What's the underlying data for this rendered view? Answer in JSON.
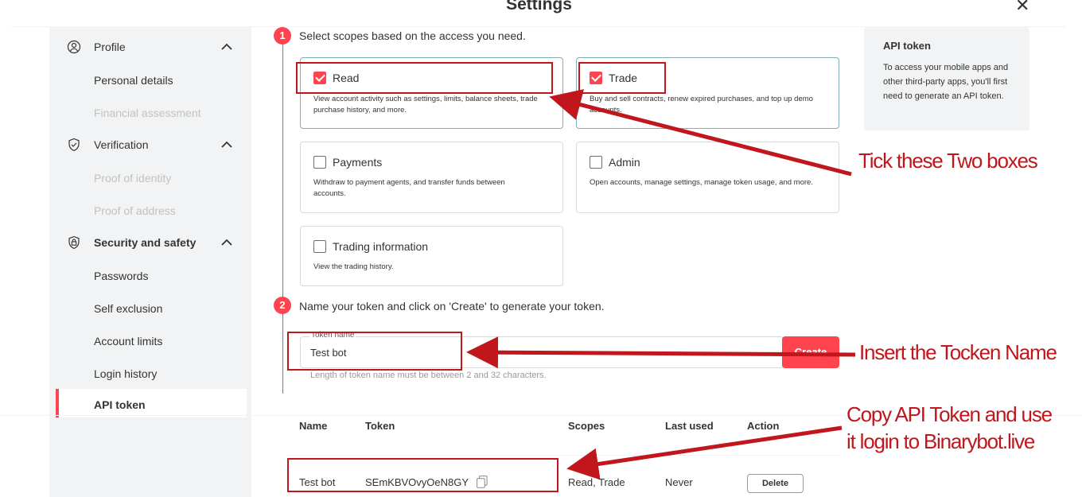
{
  "header": {
    "title": "Settings",
    "close_icon": "close-icon"
  },
  "sidebar": {
    "groups": [
      {
        "label": "Profile",
        "icon": "user-icon",
        "items": [
          {
            "label": "Personal details",
            "disabled": false
          },
          {
            "label": "Financial assessment",
            "disabled": true
          }
        ]
      },
      {
        "label": "Verification",
        "icon": "shield-check-icon",
        "items": [
          {
            "label": "Proof of identity",
            "disabled": true
          },
          {
            "label": "Proof of address",
            "disabled": true
          }
        ]
      },
      {
        "label": "Security and safety",
        "icon": "lock-icon",
        "items": [
          {
            "label": "Passwords"
          },
          {
            "label": "Self exclusion"
          },
          {
            "label": "Account limits"
          },
          {
            "label": "Login history"
          },
          {
            "label": "API token",
            "active": true
          }
        ]
      }
    ]
  },
  "steps": {
    "step1": {
      "number": "1",
      "text": "Select scopes based on the access you need."
    },
    "step2": {
      "number": "2",
      "text": "Name your token and click on 'Create' to generate your token."
    }
  },
  "scopes": [
    {
      "title": "Read",
      "checked": true,
      "desc": "View account activity such as settings, limits, balance sheets, trade purchase history, and more."
    },
    {
      "title": "Trade",
      "checked": true,
      "desc": "Buy and sell contracts, renew expired purchases, and top up demo accounts."
    },
    {
      "title": "Payments",
      "checked": false,
      "desc": "Withdraw to payment agents, and transfer funds between accounts."
    },
    {
      "title": "Admin",
      "checked": false,
      "desc": "Open accounts, manage settings, manage token usage, and more."
    },
    {
      "title": "Trading information",
      "checked": false,
      "desc": "View the trading history."
    }
  ],
  "info": {
    "title": "API token",
    "body": "To access your mobile apps and other third-party apps, you'll first need to generate an API token."
  },
  "token_form": {
    "label": "Token name",
    "value": "Test bot",
    "create_label": "Create",
    "hint": "Length of token name must be between 2 and 32 characters."
  },
  "table": {
    "headers": {
      "name": "Name",
      "token": "Token",
      "scopes": "Scopes",
      "last_used": "Last used",
      "action": "Action"
    },
    "rows": [
      {
        "name": "Test bot",
        "token": "SEmKBVOvyOeN8GY",
        "scopes": "Read, Trade",
        "last_used": "Never",
        "action": "Delete"
      }
    ]
  },
  "annotations": {
    "tick": "Tick these Two boxes",
    "insert": "Insert the Tocken Name",
    "copy_line1": "Copy API Token and use",
    "copy_line2": "it login to Binarybot.live",
    "color": "#c0161c"
  },
  "colors": {
    "accent": "#ff444f",
    "sidebar_bg": "#f2f3f4",
    "annotation": "#c0161c"
  }
}
